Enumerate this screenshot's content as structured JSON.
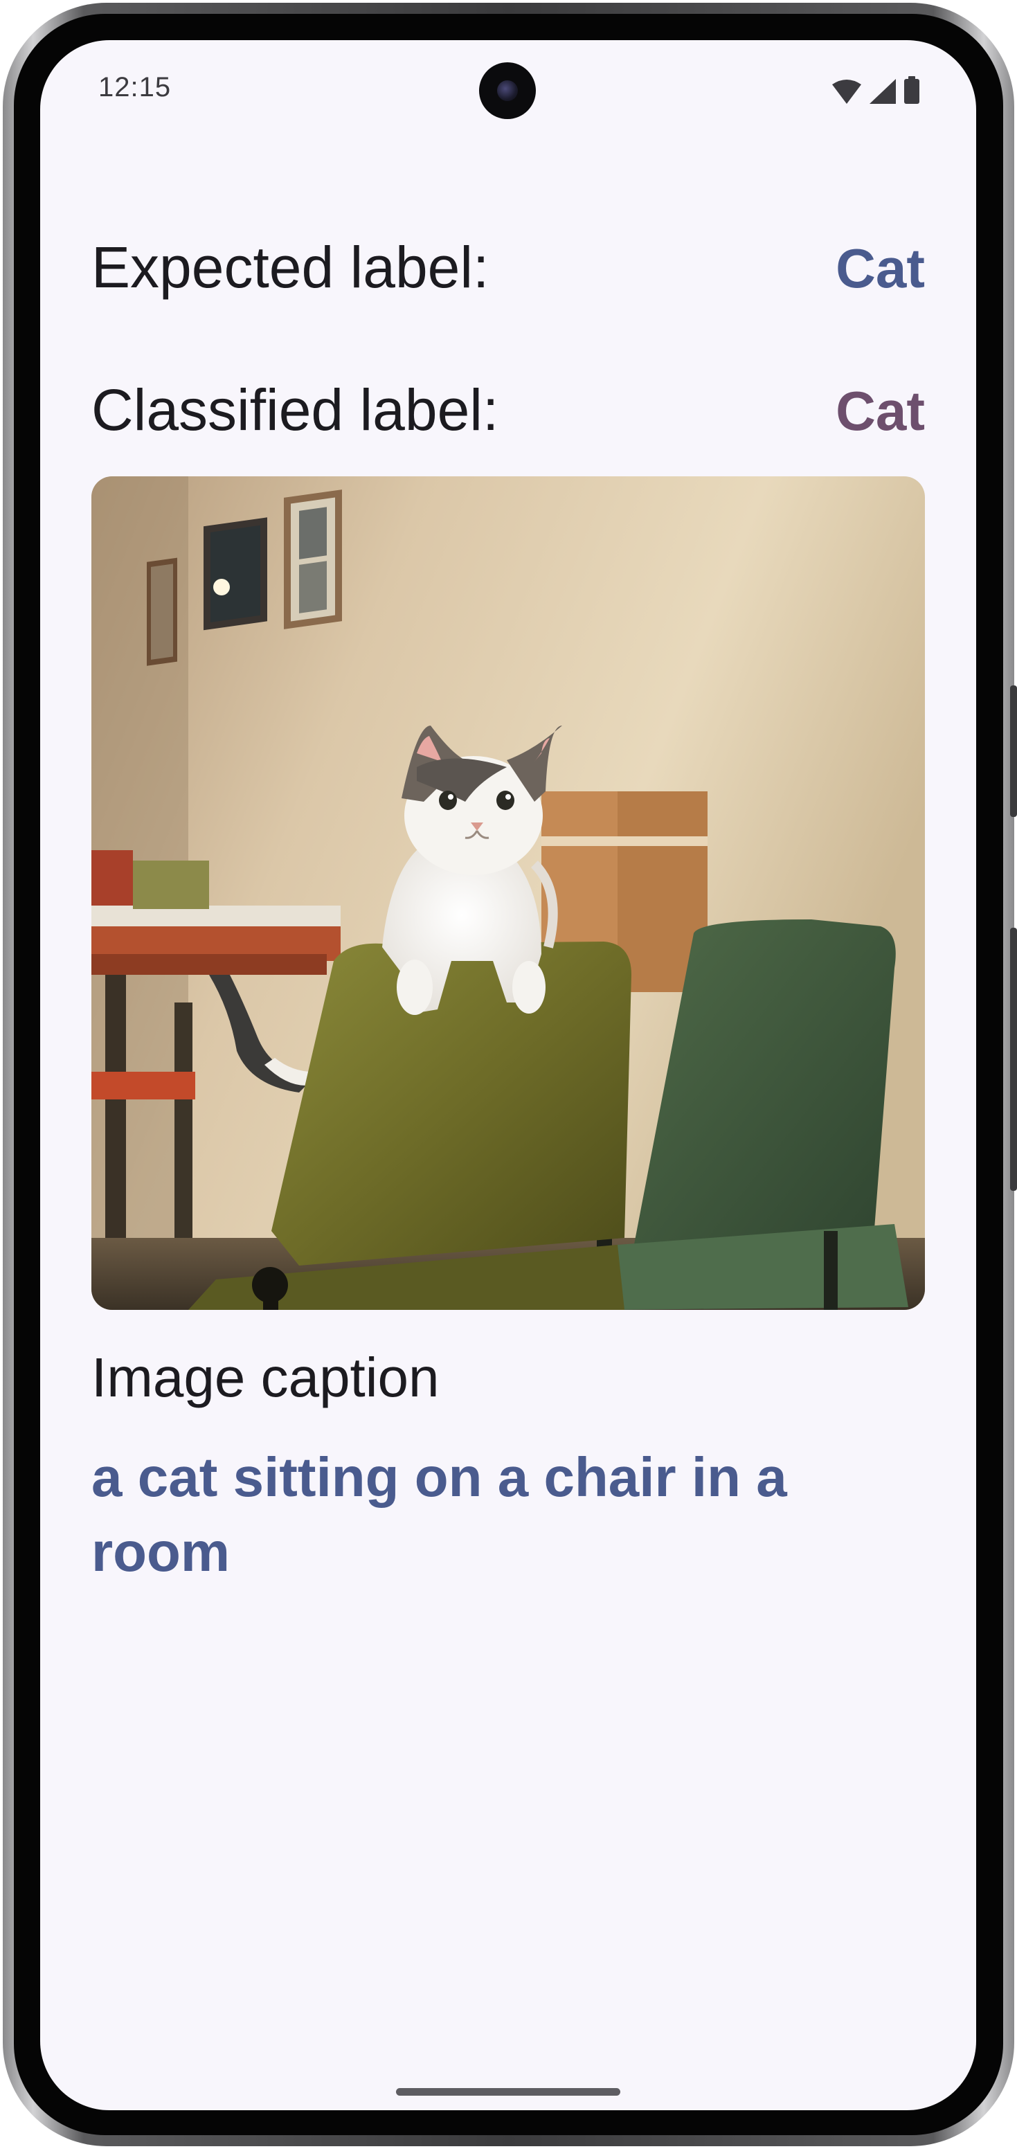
{
  "status_bar": {
    "time": "12:15",
    "icons": [
      "wifi-icon",
      "cellular-signal-icon",
      "battery-icon"
    ]
  },
  "expected": {
    "label": "Expected label:",
    "value": "Cat",
    "color": "#4a5b8e"
  },
  "classified": {
    "label": "Classified label:",
    "value": "Cat",
    "color": "#6d4f6d"
  },
  "image": {
    "subject": "cat-on-chair-photo"
  },
  "caption": {
    "title": "Image caption",
    "text": "a cat sitting on a chair in a room",
    "color": "#4a5b8e"
  }
}
